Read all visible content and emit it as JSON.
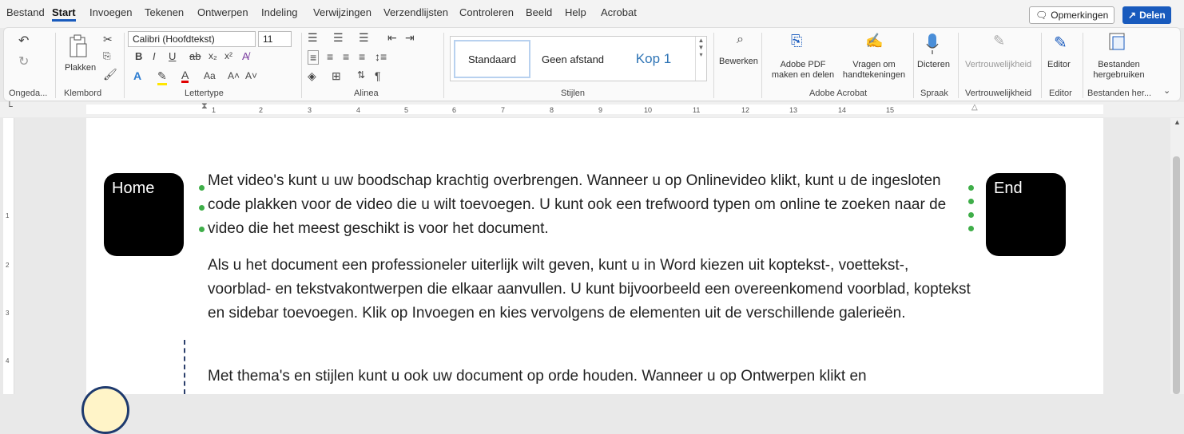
{
  "menu": {
    "tabs": [
      "Bestand",
      "Start",
      "Invoegen",
      "Tekenen",
      "Ontwerpen",
      "Indeling",
      "Verwijzingen",
      "Verzendlijsten",
      "Controleren",
      "Beeld",
      "Help",
      "Acrobat"
    ],
    "active_tab": "Start",
    "comments_label": "Opmerkingen",
    "share_label": "Delen"
  },
  "ribbon": {
    "undo_group": "Ongeda...",
    "clipboard": {
      "paste_label": "Plakken",
      "group": "Klembord"
    },
    "font": {
      "name": "Calibri (Hoofdtekst)",
      "size": "11",
      "group": "Lettertype"
    },
    "paragraph": {
      "group": "Alinea"
    },
    "styles": {
      "items": [
        "Standaard",
        "Geen afstand",
        "Kop 1"
      ],
      "group": "Stijlen"
    },
    "editing": {
      "label": "Bewerken"
    },
    "acrobat": {
      "create_label_1": "Adobe PDF",
      "create_label_2": "maken en delen",
      "sign_label_1": "Vragen om",
      "sign_label_2": "handtekeningen",
      "group": "Adobe Acrobat"
    },
    "voice": {
      "label": "Dicteren",
      "group": "Spraak"
    },
    "sensitivity": {
      "label": "Vertrouwelijkheid",
      "group": "Vertrouwelijkheid"
    },
    "editor": {
      "label": "Editor",
      "group": "Editor"
    },
    "reuse": {
      "label_1": "Bestanden",
      "label_2": "hergebruiken",
      "group": "Bestanden her..."
    }
  },
  "ruler": {
    "numbers": [
      "1",
      "2",
      "3",
      "4",
      "5",
      "6",
      "7",
      "8",
      "9",
      "10",
      "11",
      "12",
      "13",
      "14",
      "15"
    ]
  },
  "vruler": {
    "numbers": [
      "1",
      "2",
      "3",
      "4"
    ]
  },
  "document": {
    "home_key": "Home",
    "end_key": "End",
    "paragraphs": [
      "Met video's kunt u uw boodschap krachtig overbrengen. Wanneer u op Onlinevideo klikt, kunt u de ingesloten code plakken voor de video die u wilt toevoegen. U kunt ook een trefwoord typen om online te zoeken naar de video die het meest geschikt is voor het document.",
      "Als u het document een professioneler uiterlijk wilt geven, kunt u in Word kiezen uit koptekst-, voettekst-, voorblad- en tekstvakontwerpen die elkaar aanvullen. U kunt bijvoorbeeld een overeenkomend voorblad, koptekst en sidebar toevoegen. Klik op Invoegen en kies vervolgens de elementen uit de verschillende galerieën.",
      "Met thema's en stijlen kunt u ook uw document op orde houden. Wanneer u op Ontwerpen klikt en"
    ]
  }
}
